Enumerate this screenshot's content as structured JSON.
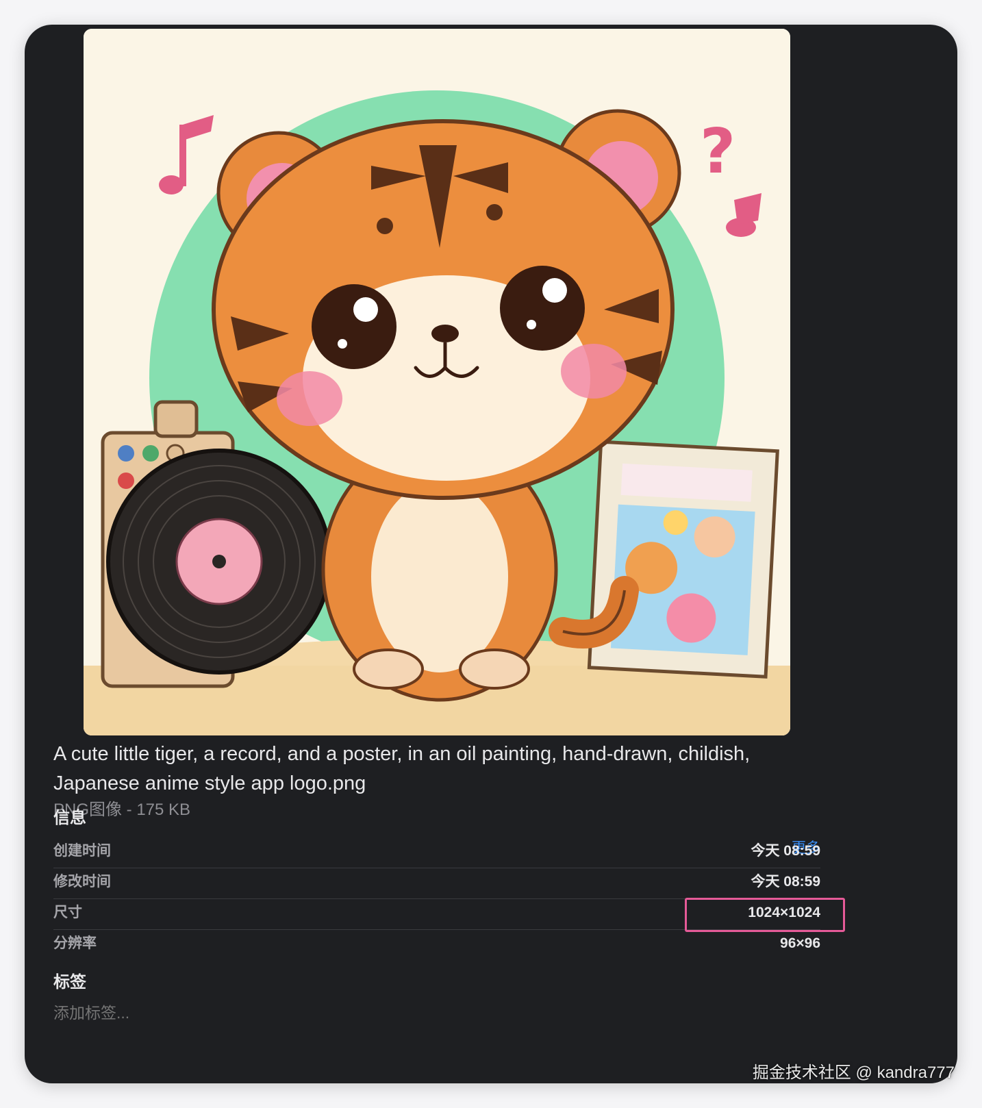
{
  "file": {
    "name": "A cute little tiger, a record, and a poster, in an oil painting, hand-drawn, childish, Japanese anime style app logo.png",
    "kind_size": "PNG图像 - 175 KB"
  },
  "info": {
    "title": "信息",
    "more_label": "更多",
    "rows": [
      {
        "label": "创建时间",
        "value": "今天 08:59"
      },
      {
        "label": "修改时间",
        "value": "今天 08:59"
      },
      {
        "label": "尺寸",
        "value": "1024×1024"
      },
      {
        "label": "分辨率",
        "value": "96×96"
      }
    ]
  },
  "tags": {
    "title": "标签",
    "placeholder": "添加标签..."
  },
  "watermark": "掘金技术社区 @ kandra777",
  "colors": {
    "panel_bg": "#1e1f22",
    "accent_link": "#3a8ef6",
    "highlight": "#e55a98"
  }
}
